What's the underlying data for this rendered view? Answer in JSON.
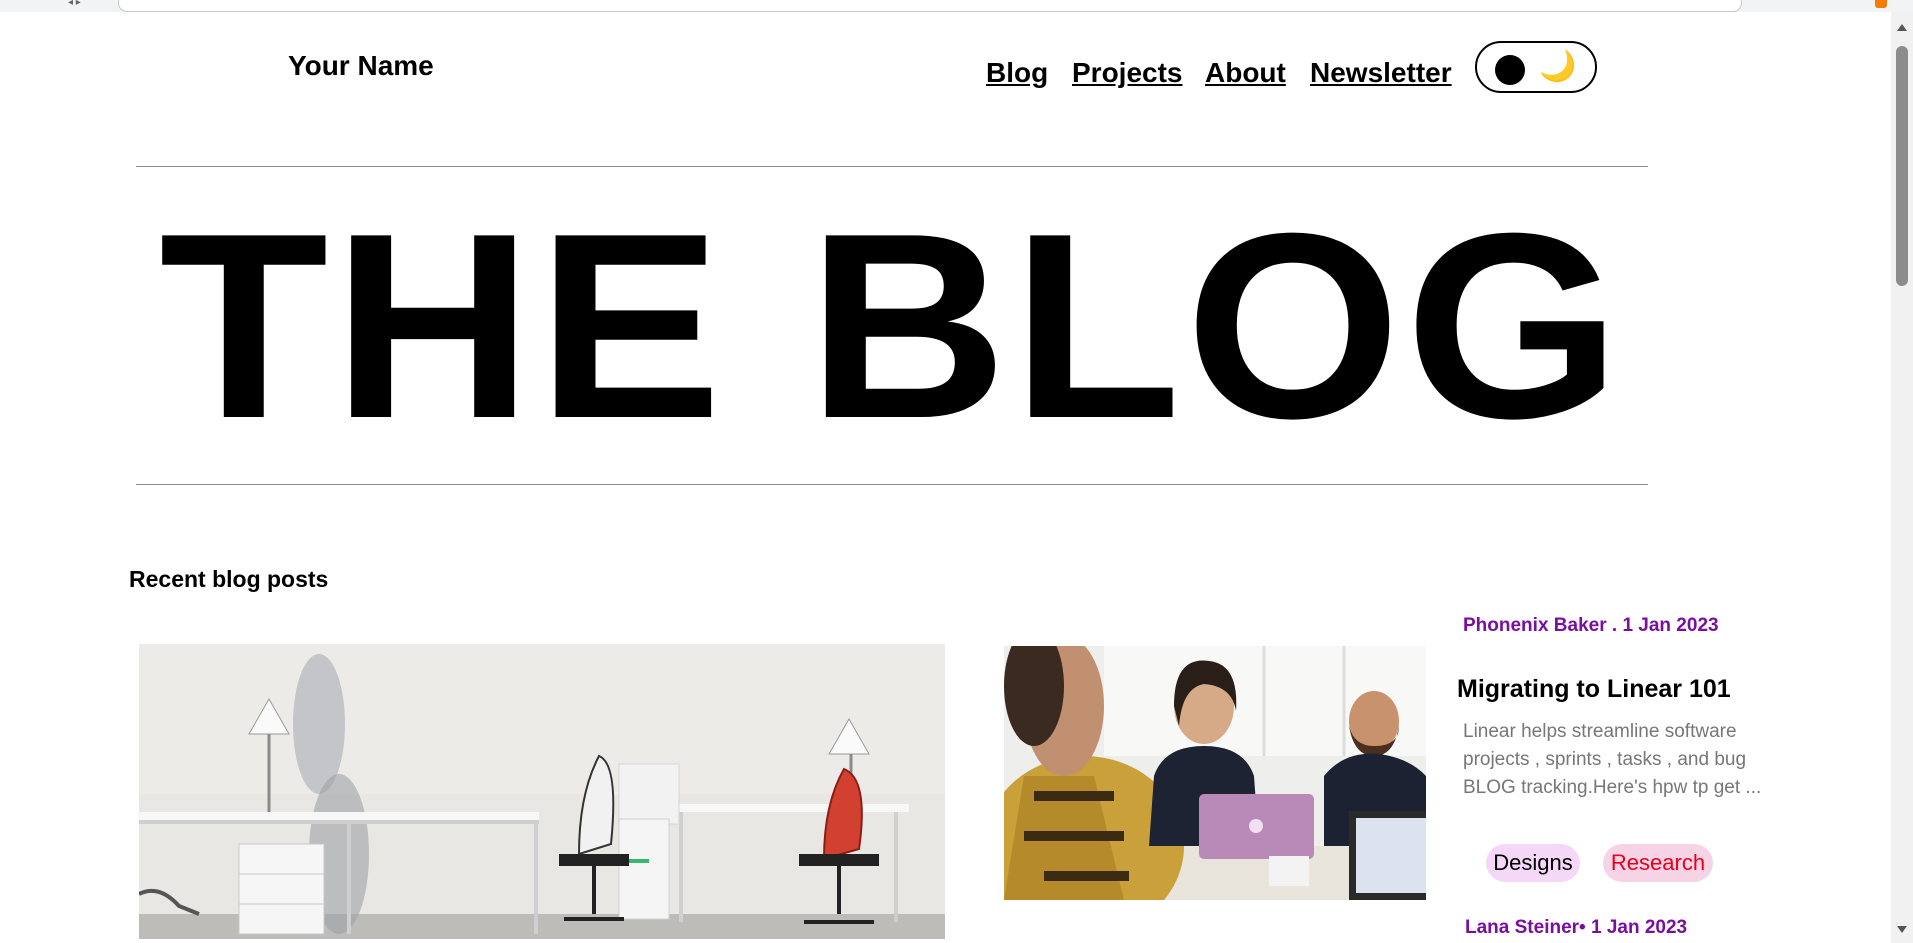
{
  "header": {
    "brand": "Your Name",
    "nav": [
      "Blog",
      "Projects",
      "About",
      "Newsletter"
    ],
    "theme_toggle_moon": "🌙"
  },
  "hero": {
    "title": "THE BLOG"
  },
  "recent": {
    "title": "Recent blog posts",
    "posts": [
      {
        "meta": "Phonenix Baker . 1 Jan 2023",
        "title": "Migrating to Linear 101",
        "excerpt": "Linear helps streamline software projects , sprints , tasks , and bug BLOG tracking.Here's hpw tp get ...",
        "tags": [
          "Designs",
          "Research"
        ]
      },
      {
        "meta": "Lana Steiner• 1 Jan 2023"
      }
    ]
  },
  "colors": {
    "meta": "#7a0ea0",
    "tag_design_bg": "#f5d8f7",
    "tag_research_bg": "#f7d3e6",
    "tag_research_text": "#e8001c"
  }
}
